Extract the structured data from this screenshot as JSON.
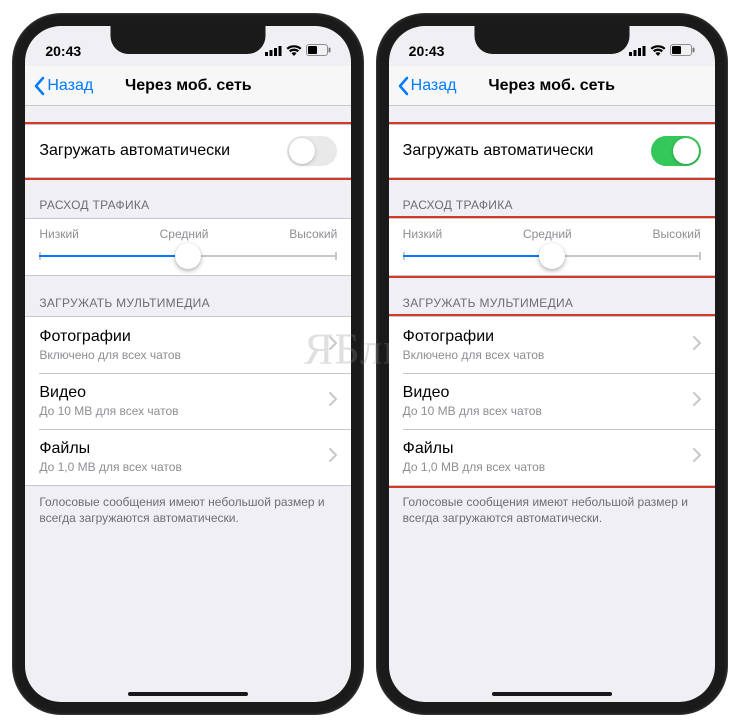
{
  "watermark": "ЯБлык",
  "phones": [
    {
      "status": {
        "time": "20:43"
      },
      "nav": {
        "back": "Назад",
        "title": "Через моб. сеть"
      },
      "auto_download": {
        "label": "Загружать автоматически",
        "on": false,
        "highlight": true
      },
      "traffic": {
        "header": "РАСХОД ТРАФИКА",
        "low": "Низкий",
        "mid": "Средний",
        "high": "Высокий",
        "position": 50,
        "highlight": false
      },
      "media": {
        "header": "ЗАГРУЖАТЬ МУЛЬТИМЕДИА",
        "highlight": false,
        "items": [
          {
            "title": "Фотографии",
            "sub": "Включено для всех чатов"
          },
          {
            "title": "Видео",
            "sub": "До 10 MB для всех чатов"
          },
          {
            "title": "Файлы",
            "sub": "До 1,0 MB для всех чатов"
          }
        ],
        "footer": "Голосовые сообщения имеют небольшой размер и всегда загружаются автоматически."
      }
    },
    {
      "status": {
        "time": "20:43"
      },
      "nav": {
        "back": "Назад",
        "title": "Через моб. сеть"
      },
      "auto_download": {
        "label": "Загружать автоматически",
        "on": true,
        "highlight": true
      },
      "traffic": {
        "header": "РАСХОД ТРАФИКА",
        "low": "Низкий",
        "mid": "Средний",
        "high": "Высокий",
        "position": 50,
        "highlight": true
      },
      "media": {
        "header": "ЗАГРУЖАТЬ МУЛЬТИМЕДИА",
        "highlight": true,
        "items": [
          {
            "title": "Фотографии",
            "sub": "Включено для всех чатов"
          },
          {
            "title": "Видео",
            "sub": "До 10 MB для всех чатов"
          },
          {
            "title": "Файлы",
            "sub": "До 1,0 MB для всех чатов"
          }
        ],
        "footer": "Голосовые сообщения имеют небольшой размер и всегда загружаются автоматически."
      }
    }
  ]
}
